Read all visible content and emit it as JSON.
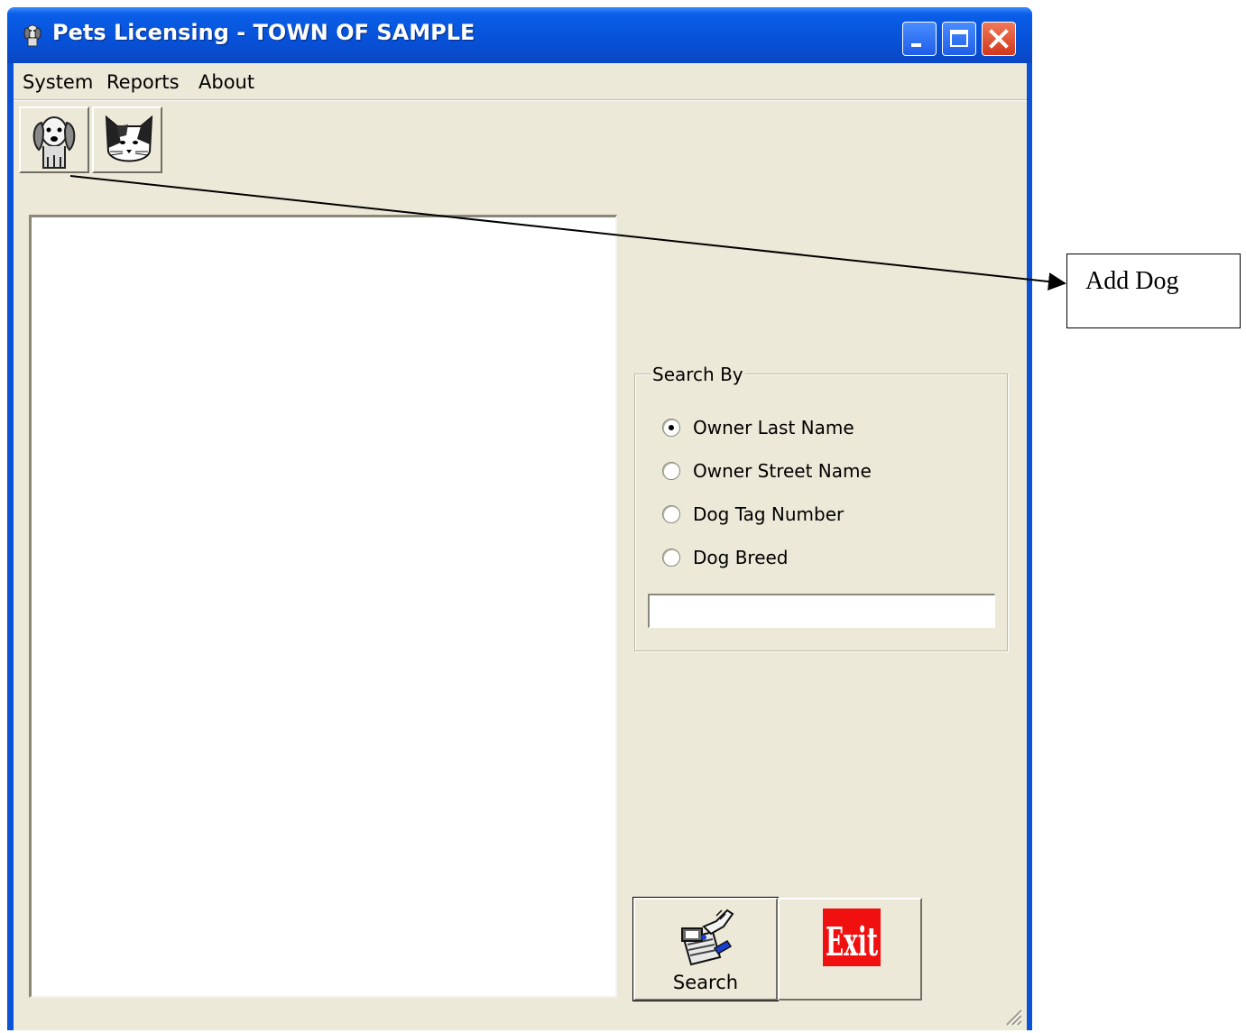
{
  "window": {
    "title": "Pets Licensing - TOWN OF SAMPLE",
    "title_icon": "dog-icon"
  },
  "menu": {
    "system": "System",
    "reports": "Reports",
    "about": "About"
  },
  "toolbar": {
    "add_dog_icon": "dog-icon",
    "cat_icon": "cat-icon"
  },
  "search_group": {
    "legend": "Search By",
    "options": [
      {
        "label": "Owner Last Name",
        "selected": true
      },
      {
        "label": "Owner Street Name",
        "selected": false
      },
      {
        "label": "Dog Tag Number",
        "selected": false
      },
      {
        "label": "Dog Breed",
        "selected": false
      }
    ],
    "input_value": ""
  },
  "buttons": {
    "search_label": "Search",
    "exit_label": "Exit"
  },
  "annotation": {
    "label": "Add Dog"
  }
}
